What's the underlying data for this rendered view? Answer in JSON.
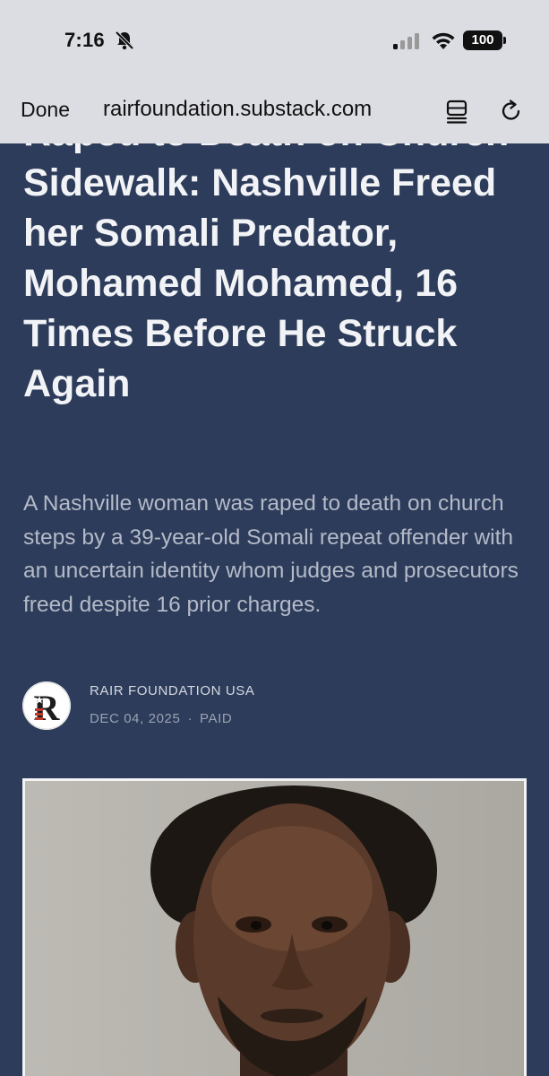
{
  "status_bar": {
    "time": "7:16",
    "battery": "100"
  },
  "browser": {
    "done_label": "Done",
    "url": "rairfoundation.substack.com"
  },
  "article": {
    "title": "Raped to Death on Church Sidewalk: Nashville Freed her Somali Predator, Mohamed Mohamed, 16 Times Before He Struck Again",
    "subtitle": "A Nashville woman was raped to death on church steps by a 39-year-old Somali repeat offender with an uncertain identity whom judges and prosecutors freed despite 16 prior charges.",
    "author": "RAIR FOUNDATION USA",
    "date": "DEC 04, 2025",
    "access": "PAID",
    "separator": "·"
  },
  "colors": {
    "page_background": "#2d3c5a",
    "chrome_background": "#dcdde3",
    "headline": "#f2f3f6",
    "subtitle": "#b4bac8"
  },
  "icons": [
    "bell-slash-icon",
    "cellular-signal-icon",
    "wifi-icon",
    "battery-icon",
    "reader-mode-icon",
    "reload-icon"
  ]
}
